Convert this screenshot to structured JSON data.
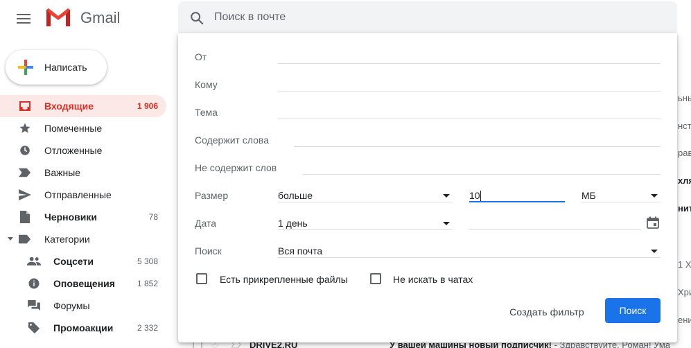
{
  "app": {
    "name": "Gmail"
  },
  "search": {
    "placeholder": "Поиск в почте"
  },
  "compose": {
    "label": "Написать"
  },
  "sidebar": {
    "items": [
      {
        "label": "Входящие",
        "count": "1 906",
        "icon": "inbox-icon",
        "active": true
      },
      {
        "label": "Помеченные",
        "count": "",
        "icon": "star-icon"
      },
      {
        "label": "Отложенные",
        "count": "",
        "icon": "clock-icon"
      },
      {
        "label": "Важные",
        "count": "",
        "icon": "label-important-icon"
      },
      {
        "label": "Отправленные",
        "count": "",
        "icon": "send-icon"
      },
      {
        "label": "Черновики",
        "count": "78",
        "icon": "draft-icon"
      },
      {
        "label": "Категории",
        "count": "",
        "icon": "label-icon"
      },
      {
        "label": "Соцсети",
        "count": "5 308",
        "icon": "people-icon"
      },
      {
        "label": "Оповещения",
        "count": "1 852",
        "icon": "info-icon"
      },
      {
        "label": "Форумы",
        "count": "",
        "icon": "forum-icon"
      },
      {
        "label": "Промоакции",
        "count": "2 332",
        "icon": "tag-icon"
      }
    ]
  },
  "advanced": {
    "from_label": "От",
    "to_label": "Кому",
    "subject_label": "Тема",
    "has_words_label": "Содержит слова",
    "no_words_label": "Не содержит слов",
    "size_label": "Размер",
    "size_operator": "больше",
    "size_value": "10",
    "size_unit": "МБ",
    "date_label": "Дата",
    "date_within": "1 день",
    "search_label": "Поиск",
    "search_scope": "Вся почта",
    "has_attachment_label": "Есть прикрепленные файлы",
    "exclude_chats_label": "Не искать в чатах",
    "create_filter_label": "Создать фильтр",
    "search_button_label": "Поиск"
  },
  "background": {
    "fragments": [
      "нстр",
      "рав",
      "хляс",
      "нить",
      "1 Хр",
      "Хрис",
      "ения",
      "ьные"
    ],
    "bottom_row": {
      "sender": "DRIVE2.RU",
      "subject": "У вашей машины новый подписчик!",
      "snippet": " - Здравствуйте, Роман! Ума"
    }
  },
  "colors": {
    "accent": "#1a73e8",
    "inbox_active_bg": "#fce8e6",
    "inbox_active_text": "#d93025"
  }
}
